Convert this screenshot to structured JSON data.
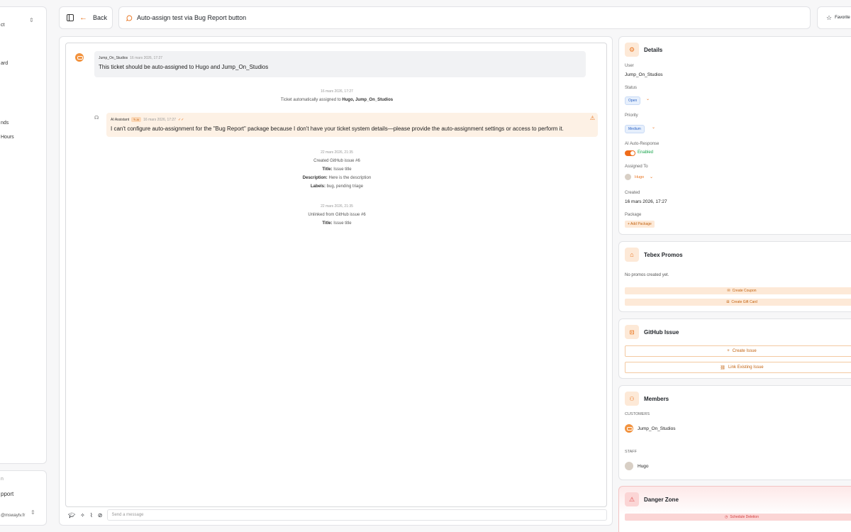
{
  "sidebar": {
    "items": [
      "ct",
      "ard",
      "nds",
      "Hours"
    ],
    "bottom_header": "n",
    "bottom_label": "pport",
    "bottom_email": "@mswaytv.fr"
  },
  "topbar": {
    "back_label": "Back",
    "ticket_title": "Auto-assign test via Bug Report button",
    "favorite_label": "Favorite"
  },
  "chat": {
    "message1": {
      "author": "Jump_On_Studios",
      "datetime": "16 mars 2026, 17:27",
      "text": "This ticket should be auto-assigned to Hugo and Jump_On_Studios"
    },
    "system1": {
      "datetime": "16 mars 2026, 17:27",
      "text_prefix": "Ticket automatically assigned to ",
      "text_bold": "Hugo, Jump_On_Studios"
    },
    "ai_message": {
      "author": "AI Assistant",
      "badge": "AI",
      "datetime": "16 mars 2026, 17:27",
      "text": "I can't configure auto-assignment for the \"Bug Report\" package because I don't have your ticket system details—please provide the auto-assignment settings or access to perform it."
    },
    "system2": {
      "datetime": "22 mars 2026, 21:35",
      "line1": "Created GitHub issue #6",
      "title_label": "Title:",
      "title_value": " Issue title",
      "desc_label": "Description:",
      "desc_value": " Here is the description",
      "labels_label": "Labels:",
      "labels_value": " bug, pending triage"
    },
    "system3": {
      "datetime": "22 mars 2026, 21:35",
      "line1": "Unlinked from GitHub issue #6",
      "title_label": "Title:",
      "title_value": " Issue title"
    },
    "composer_placeholder": "Send a message"
  },
  "details": {
    "title": "Details",
    "user_label": "User",
    "user_value": "Jump_On_Studios",
    "status_label": "Status",
    "status_value": "Open",
    "priority_label": "Priority",
    "priority_value": "Medium",
    "ai_label": "AI Auto-Response",
    "ai_value": "Enabled",
    "assigned_label": "Assigned To",
    "assigned_value": "Hugo",
    "created_label": "Created",
    "created_value": "16 mars 2026, 17:27",
    "package_label": "Package",
    "add_package": "Add Package"
  },
  "promos": {
    "title": "Tebex Promos",
    "empty": "No promos created yet.",
    "create_coupon": "Create Coupon",
    "create_gift_card": "Create Gift Card"
  },
  "github": {
    "title": "GitHub Issue",
    "create_issue": "Create Issue",
    "link_issue": "Link Existing Issue"
  },
  "members": {
    "title": "Members",
    "customers_label": "CUSTOMERS",
    "customer_name": "Jump_On_Studios",
    "staff_label": "STAFF",
    "staff_name": "Hugo"
  },
  "danger": {
    "title": "Danger Zone",
    "schedule_deletion": "Schedule Deletion"
  },
  "colors": {
    "accent": "#e8711a",
    "enabled_green": "#16a34a",
    "danger_red": "#e04a4a"
  }
}
